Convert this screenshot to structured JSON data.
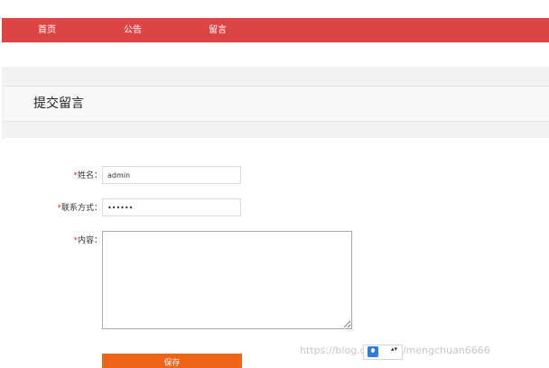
{
  "nav": {
    "items": [
      {
        "label": "首页"
      },
      {
        "label": "公告"
      },
      {
        "label": "留言"
      }
    ]
  },
  "page": {
    "title": "提交留言"
  },
  "form": {
    "required_mark": "*",
    "name": {
      "label": "姓名：",
      "value": "admin"
    },
    "contact": {
      "label": "联系方式：",
      "value": "••••••"
    },
    "content": {
      "label": "内容：",
      "value": ""
    },
    "save_label": "保存"
  },
  "watermark": {
    "text": "https://blog.csdn.net/mengchuan6666"
  },
  "overlay": {
    "icon": "input-method-icon",
    "arrows": "▴▾"
  },
  "colors": {
    "nav_bg": "#dd4444",
    "button_bg": "#f06418",
    "required": "#dd3333"
  }
}
